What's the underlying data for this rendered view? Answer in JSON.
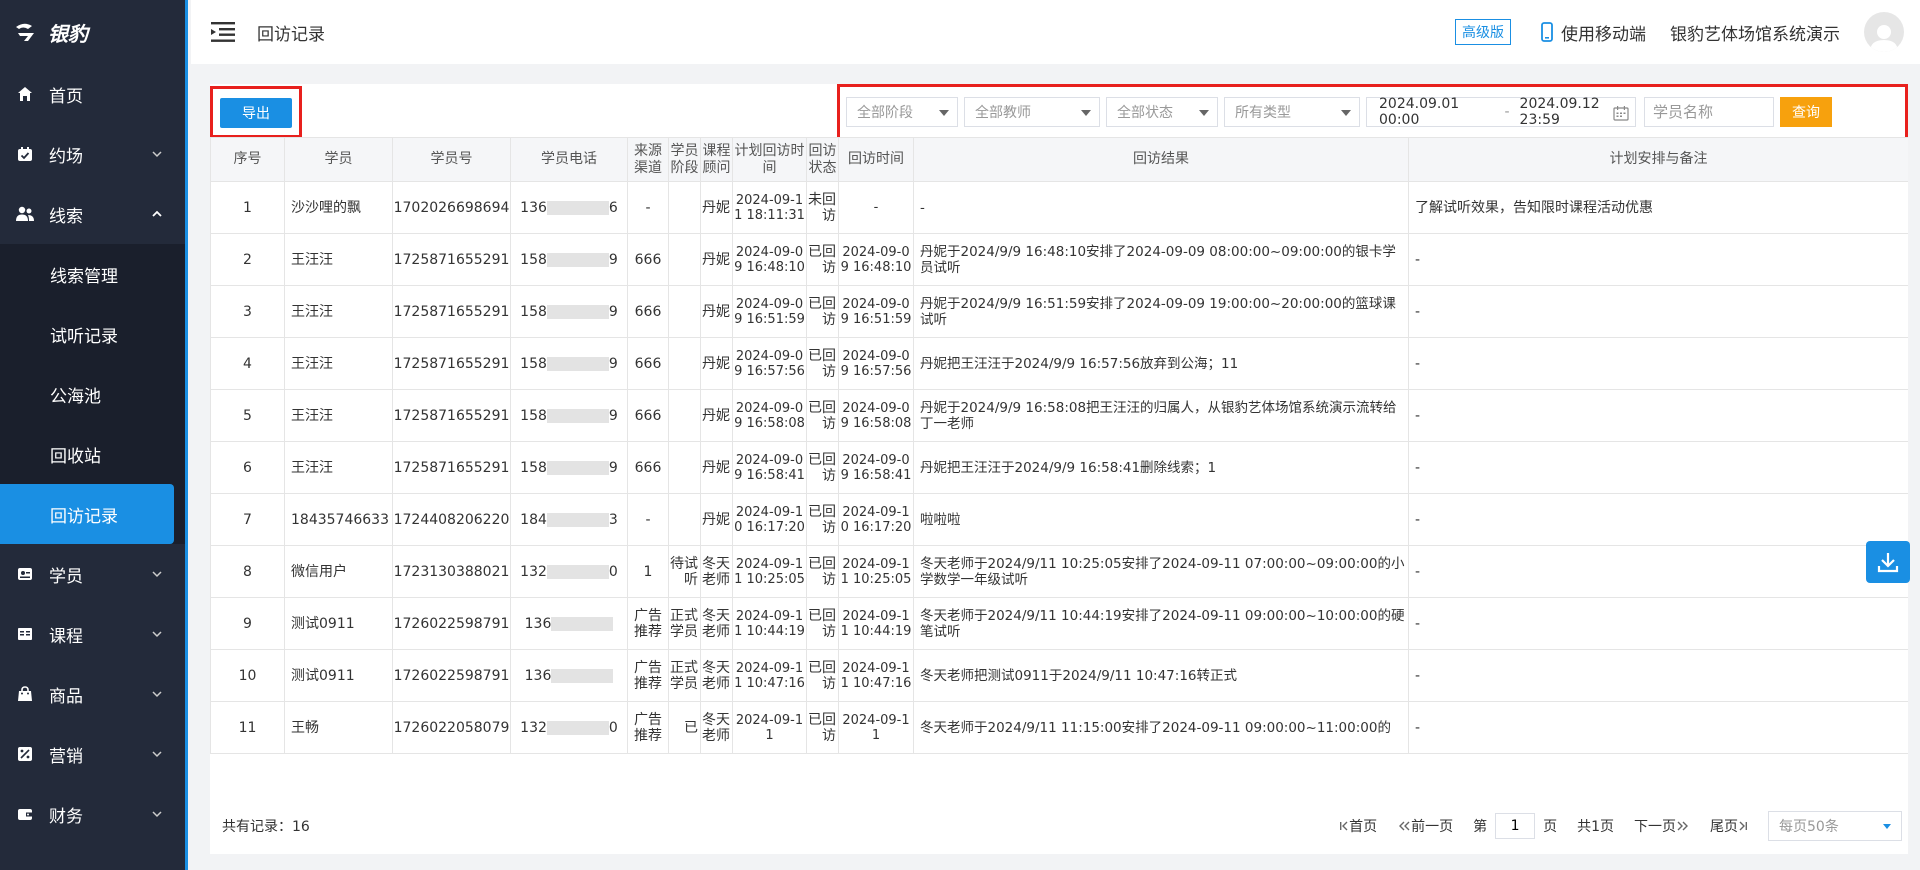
{
  "app": {
    "logo_text": "银豹"
  },
  "sidebar": {
    "items": [
      {
        "label": "首页",
        "icon": "home-icon"
      },
      {
        "label": "约场",
        "icon": "calendar-check-icon"
      },
      {
        "label": "线索",
        "icon": "users-icon"
      },
      {
        "label": "学员",
        "icon": "id-card-icon"
      },
      {
        "label": "课程",
        "icon": "book-icon"
      },
      {
        "label": "商品",
        "icon": "shopping-bag-icon"
      },
      {
        "label": "营销",
        "icon": "percent-icon"
      },
      {
        "label": "财务",
        "icon": "wallet-icon"
      }
    ],
    "sub_items": [
      "线索管理",
      "试听记录",
      "公海池",
      "回收站",
      "回访记录"
    ],
    "active_sub": "回访记录"
  },
  "header": {
    "breadcrumb": "回访记录",
    "edition_badge": "高级版",
    "mobile_label": "使用移动端",
    "org_name": "银豹艺体场馆系统演示"
  },
  "toolbar": {
    "export_label": "导出",
    "stage_select": "全部阶段",
    "teacher_select": "全部教师",
    "status_select": "全部状态",
    "type_select": "所有类型",
    "date_start": "2024.09.01 00:00",
    "date_sep": "-",
    "date_end": "2024.09.12 23:59",
    "name_placeholder": "学员名称",
    "query_label": "查询"
  },
  "table": {
    "headers": [
      "序号",
      "学员",
      "学员号",
      "学员电话",
      "来源渠道",
      "学员阶段",
      "课程顾问",
      "计划回访时间",
      "回访状态",
      "回访时间",
      "回访结果",
      "计划安排与备注"
    ],
    "rows": [
      {
        "no": "1",
        "student": "沙沙哩的飘",
        "id": "1702026698694",
        "phone_pre": "136",
        "phone_suf": "6",
        "source": "-",
        "stage": "",
        "advisor": "丹妮",
        "plan_time": "2024-09-11 18:11:31",
        "status": "未回访",
        "visit_time": "-",
        "result": "-",
        "note": "了解试听效果，告知限时课程活动优惠"
      },
      {
        "no": "2",
        "student": "王汪汪",
        "id": "1725871655291",
        "phone_pre": "158",
        "phone_suf": "9",
        "source": "666",
        "stage": "",
        "advisor": "丹妮",
        "plan_time": "2024-09-09 16:48:10",
        "status": "已回访",
        "visit_time": "2024-09-09 16:48:10",
        "result": "丹妮于2024/9/9 16:48:10安排了2024-09-09 08:00:00~09:00:00的银卡学员试听",
        "note": "-"
      },
      {
        "no": "3",
        "student": "王汪汪",
        "id": "1725871655291",
        "phone_pre": "158",
        "phone_suf": "9",
        "source": "666",
        "stage": "",
        "advisor": "丹妮",
        "plan_time": "2024-09-09 16:51:59",
        "status": "已回访",
        "visit_time": "2024-09-09 16:51:59",
        "result": "丹妮于2024/9/9 16:51:59安排了2024-09-09 19:00:00~20:00:00的篮球课试听",
        "note": "-"
      },
      {
        "no": "4",
        "student": "王汪汪",
        "id": "1725871655291",
        "phone_pre": "158",
        "phone_suf": "9",
        "source": "666",
        "stage": "",
        "advisor": "丹妮",
        "plan_time": "2024-09-09 16:57:56",
        "status": "已回访",
        "visit_time": "2024-09-09 16:57:56",
        "result": "丹妮把王汪汪于2024/9/9 16:57:56放弃到公海；11",
        "note": "-"
      },
      {
        "no": "5",
        "student": "王汪汪",
        "id": "1725871655291",
        "phone_pre": "158",
        "phone_suf": "9",
        "source": "666",
        "stage": "",
        "advisor": "丹妮",
        "plan_time": "2024-09-09 16:58:08",
        "status": "已回访",
        "visit_time": "2024-09-09 16:58:08",
        "result": "丹妮于2024/9/9 16:58:08把王汪汪的归属人，从银豹艺体场馆系统演示流转给丁一老师",
        "note": "-"
      },
      {
        "no": "6",
        "student": "王汪汪",
        "id": "1725871655291",
        "phone_pre": "158",
        "phone_suf": "9",
        "source": "666",
        "stage": "",
        "advisor": "丹妮",
        "plan_time": "2024-09-09 16:58:41",
        "status": "已回访",
        "visit_time": "2024-09-09 16:58:41",
        "result": "丹妮把王汪汪于2024/9/9 16:58:41删除线索；1",
        "note": "-"
      },
      {
        "no": "7",
        "student": "18435746633",
        "id": "1724408206220",
        "phone_pre": "184",
        "phone_suf": "3",
        "source": "-",
        "stage": "",
        "advisor": "丹妮",
        "plan_time": "2024-09-10 16:17:20",
        "status": "已回访",
        "visit_time": "2024-09-10 16:17:20",
        "result": "啦啦啦",
        "note": "-"
      },
      {
        "no": "8",
        "student": "微信用户",
        "id": "1723130388021",
        "phone_pre": "132",
        "phone_suf": "0",
        "source": "1",
        "stage": "待试听",
        "advisor": "冬天老师",
        "plan_time": "2024-09-11 10:25:05",
        "status": "已回访",
        "visit_time": "2024-09-11 10:25:05",
        "result": "冬天老师于2024/9/11 10:25:05安排了2024-09-11 07:00:00~09:00:00的小学数学一年级试听",
        "note": "-"
      },
      {
        "no": "9",
        "student": "测试0911",
        "id": "1726022598791",
        "phone_pre": "136",
        "phone_suf": "",
        "source": "广告推荐",
        "stage": "正式学员",
        "advisor": "冬天老师",
        "plan_time": "2024-09-11 10:44:19",
        "status": "已回访",
        "visit_time": "2024-09-11 10:44:19",
        "result": "冬天老师于2024/9/11 10:44:19安排了2024-09-11 09:00:00~10:00:00的硬笔试听",
        "note": "-"
      },
      {
        "no": "10",
        "student": "测试0911",
        "id": "1726022598791",
        "phone_pre": "136",
        "phone_suf": "",
        "source": "广告推荐",
        "stage": "正式学员",
        "advisor": "冬天老师",
        "plan_time": "2024-09-11 10:47:16",
        "status": "已回访",
        "visit_time": "2024-09-11 10:47:16",
        "result": "冬天老师把测试0911于2024/9/11 10:47:16转正式",
        "note": "-"
      },
      {
        "no": "11",
        "student": "王畅",
        "id": "1726022058079",
        "phone_pre": "132",
        "phone_suf": "0",
        "source": "广告推荐",
        "stage": "已",
        "advisor": "冬天老师",
        "plan_time": "2024-09-11",
        "status": "已回访",
        "visit_time": "2024-09-11",
        "result": "冬天老师于2024/9/11 11:15:00安排了2024-09-11 09:00:00~11:00:00的",
        "note": "-"
      }
    ]
  },
  "footer": {
    "total_label": "共有记录：",
    "total": "16",
    "first": "首页",
    "prev": "前一页",
    "page_prefix": "第",
    "page_value": "1",
    "page_suffix": "页",
    "page_total": "共1页",
    "next": "下一页",
    "last": "尾页",
    "page_size": "每页50条"
  },
  "colors": {
    "accent": "#1a8fe3",
    "sidebar": "#232a3a",
    "query": "#f7a10d",
    "highlight": "#e8201d"
  }
}
